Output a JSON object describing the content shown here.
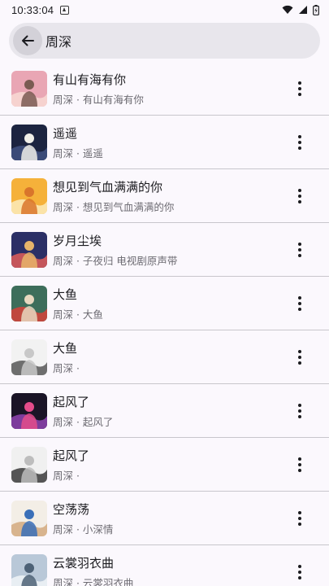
{
  "status_bar": {
    "time": "10:33:04",
    "icons": [
      "notification-icon",
      "wifi-icon",
      "signal-icon",
      "battery-icon"
    ]
  },
  "search": {
    "query": "周深",
    "back_icon": "arrow-back-icon"
  },
  "songs": [
    {
      "title": "有山有海有你",
      "subtitle": "周深 · 有山有海有你",
      "colors": [
        "#e9a6b4",
        "#f6d2cf",
        "#7a5b52"
      ]
    },
    {
      "title": "遥遥",
      "subtitle": "周深 · 遥遥",
      "colors": [
        "#1c2440",
        "#3b4b78",
        "#f0efe9"
      ]
    },
    {
      "title": "想见到气血满满的你",
      "subtitle": "周深 · 想见到气血满满的你",
      "colors": [
        "#f5b13a",
        "#fbe3a8",
        "#d9752b"
      ]
    },
    {
      "title": "岁月尘埃",
      "subtitle": "周深 · 子夜归 电视剧原声带",
      "colors": [
        "#2b2f66",
        "#c5565b",
        "#e7b46a"
      ]
    },
    {
      "title": "大鱼",
      "subtitle": "周深 · 大鱼",
      "colors": [
        "#3d6e5b",
        "#c0483e",
        "#e8d8c0"
      ]
    },
    {
      "title": "大鱼",
      "subtitle": "周深 ·",
      "colors": [
        "#f2f2f2",
        "#6e6e6e",
        "#c8c8c8"
      ]
    },
    {
      "title": "起风了",
      "subtitle": "周深 · 起风了",
      "colors": [
        "#1a1426",
        "#7d3c9c",
        "#e44c8b"
      ]
    },
    {
      "title": "起风了",
      "subtitle": "周深 ·",
      "colors": [
        "#f0f0f0",
        "#555555",
        "#bdbdbd"
      ]
    },
    {
      "title": "空荡荡",
      "subtitle": "周深 · 小深情",
      "colors": [
        "#f3eee6",
        "#d8b48e",
        "#3a6fb8"
      ]
    },
    {
      "title": "云裳羽衣曲",
      "subtitle": "周深 · 云裳羽衣曲",
      "colors": [
        "#b9c8d8",
        "#e8eef3",
        "#4d6176"
      ]
    }
  ],
  "more_icon": "more-vert-icon"
}
